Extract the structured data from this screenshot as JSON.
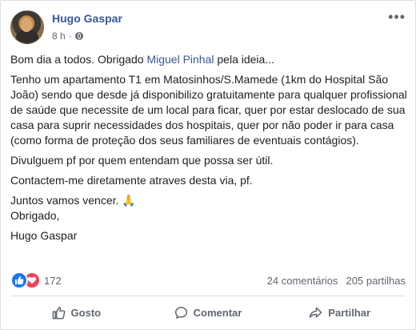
{
  "post": {
    "author": "Hugo Gaspar",
    "time": "8 h",
    "separator": "·",
    "more_icon": "more-horizontal-icon",
    "privacy_icon": "globe-icon"
  },
  "body": {
    "line1_prefix": "Bom dia a todos. Obrigado ",
    "mention": "Miguel Pinhal",
    "line1_suffix": " pela ideia...",
    "paragraph2": "Tenho um apartamento T1 em Matosinhos/S.Mamede (1km do Hospital São João) sendo que desde já disponibilizo gratuitamente para qualquer profissional de saúde que necessite de um local para ficar, quer por estar deslocado de sua casa para suprir necessidades dos hospitais, quer por não poder ir para casa (como forma de proteção dos seus familiares de eventuais contágios).",
    "paragraph3": "Divulguem pf por quem entendam que possa ser útil.",
    "paragraph4": "Contactem-me diretamente atraves desta via, pf.",
    "paragraph5_line1": "Juntos vamos vencer. 🙏",
    "paragraph5_line2": "Obrigado,",
    "signature": "Hugo Gaspar"
  },
  "stats": {
    "reactions": "172",
    "comments": "24 comentários",
    "shares": "205 partilhas"
  },
  "actions": {
    "like": "Gosto",
    "comment": "Comentar",
    "share": "Partilhar"
  },
  "colors": {
    "link": "#385898",
    "like": "#1877f2",
    "love": "#f33e58",
    "muted": "#606770"
  }
}
